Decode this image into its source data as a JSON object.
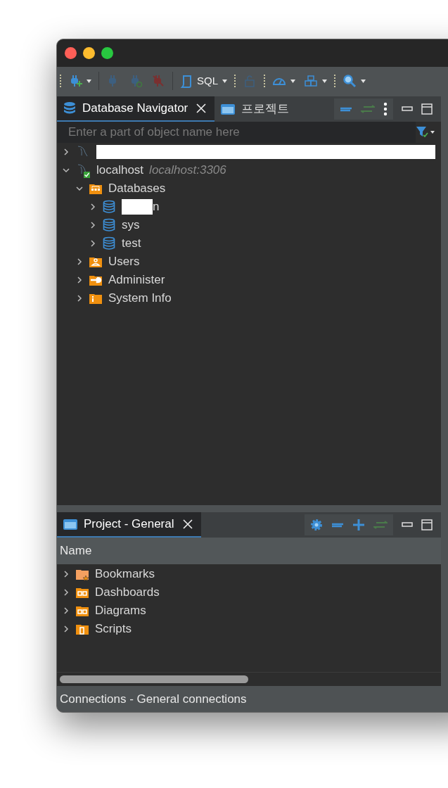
{
  "toolbar": [
    {
      "kind": "grip"
    },
    {
      "kind": "plug-add",
      "dropdown": true,
      "disabled": false
    },
    {
      "kind": "separator"
    },
    {
      "kind": "plug",
      "dropdown": false,
      "disabled": true
    },
    {
      "kind": "plug-refresh",
      "dropdown": false,
      "disabled": true
    },
    {
      "kind": "plug-off",
      "dropdown": false,
      "disabled": true
    },
    {
      "kind": "separator"
    },
    {
      "kind": "script",
      "label": "SQL",
      "dropdown": true,
      "disabled": false
    },
    {
      "kind": "grip"
    },
    {
      "kind": "lock",
      "dropdown": false,
      "disabled": true
    },
    {
      "kind": "grip"
    },
    {
      "kind": "gauge",
      "dropdown": true,
      "disabled": false
    },
    {
      "kind": "boxes",
      "dropdown": true,
      "disabled": false
    },
    {
      "kind": "grip"
    },
    {
      "kind": "search",
      "dropdown": true,
      "disabled": false
    }
  ],
  "navigator": {
    "tabs": [
      {
        "label": "Database Navigator",
        "selected": true,
        "kind": "database"
      },
      {
        "label": "프로젝트",
        "selected": false,
        "kind": "window"
      }
    ],
    "filter": {
      "placeholder": "Enter a part of object name here"
    },
    "tree": [
      {
        "kind": "connection",
        "redacted": true,
        "connected": false,
        "expanded": false
      },
      {
        "kind": "connection",
        "label": "localhost",
        "sublabel": "localhost:3306",
        "connected": true,
        "expanded": true,
        "children": [
          {
            "kind": "databases",
            "label": "Databases",
            "expanded": true,
            "children": [
              {
                "kind": "database",
                "label": "n",
                "redacted": true,
                "expanded": false
              },
              {
                "kind": "database",
                "label": "sys",
                "expanded": false
              },
              {
                "kind": "database",
                "label": "test",
                "expanded": false
              }
            ]
          },
          {
            "kind": "users",
            "label": "Users",
            "expanded": false
          },
          {
            "kind": "administer",
            "label": "Administer",
            "expanded": false
          },
          {
            "kind": "info",
            "label": "System Info",
            "expanded": false
          }
        ]
      }
    ]
  },
  "project": {
    "tabs": [
      {
        "label": "Project - General",
        "selected": true,
        "kind": "window"
      }
    ],
    "column": "Name",
    "tree": [
      {
        "kind": "bookmarks",
        "label": "Bookmarks",
        "expanded": false
      },
      {
        "kind": "dashboards",
        "label": "Dashboards",
        "expanded": false
      },
      {
        "kind": "diagrams",
        "label": "Diagrams",
        "expanded": false
      },
      {
        "kind": "scripts",
        "label": "Scripts",
        "expanded": false
      }
    ]
  },
  "status_bar": "Connections - General connections"
}
